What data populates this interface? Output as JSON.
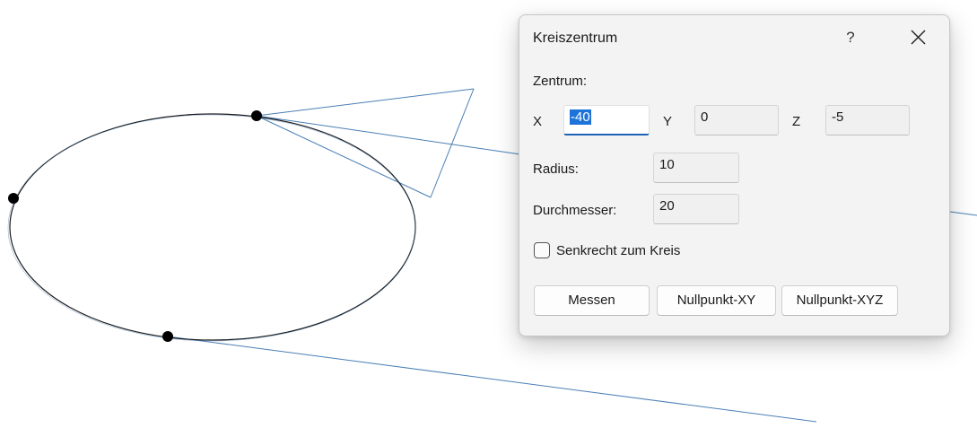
{
  "dialog": {
    "title": "Kreiszentrum",
    "help_label": "?",
    "close_icon": "close-icon",
    "center_label": "Zentrum:",
    "x_label": "X",
    "x_value": "-40",
    "y_label": "Y",
    "y_value": "0",
    "z_label": "Z",
    "z_value": "-5",
    "radius_label": "Radius:",
    "radius_value": "10",
    "diameter_label": "Durchmesser:",
    "diameter_value": "20",
    "perpendicular_label": "Senkrecht zum Kreis",
    "perpendicular_checked": false,
    "measure_button": "Messen",
    "zero_xy_button": "Nullpunkt-XY",
    "zero_xyz_button": "Nullpunkt-XYZ"
  },
  "colors": {
    "accent": "#1e62b5",
    "selection": "#1e73d8",
    "construction_line": "#4a7fb5",
    "ellipse": "#1a1a1a"
  }
}
